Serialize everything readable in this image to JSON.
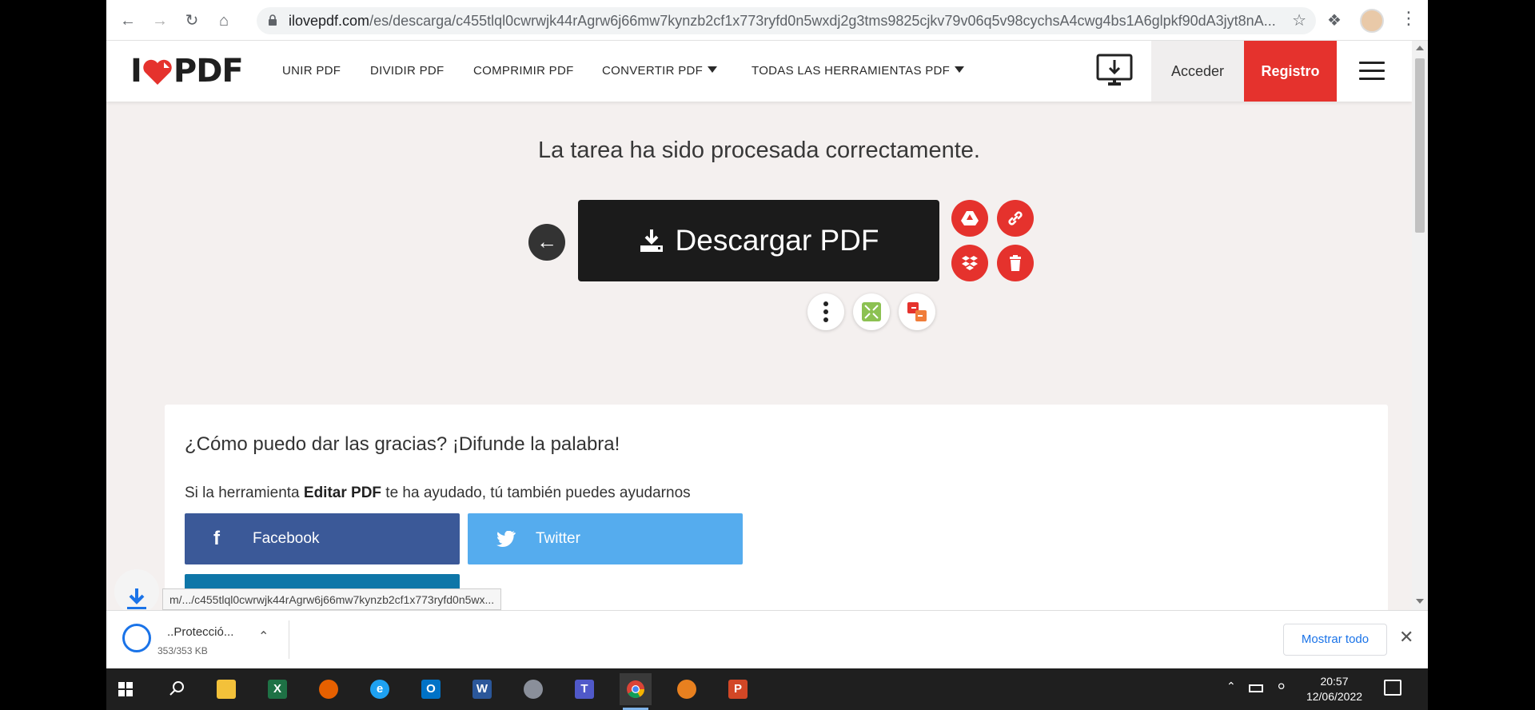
{
  "browser": {
    "url_host": "ilovepdf.com",
    "url_path": "/es/descarga/c455tlql0cwrwjk44rAgrw6j66mw7kynzb2cf1x773ryfd0n5wxdj2g3tms9825cjkv79v06q5v98cychsA4cwg4bs1A6glpkf90dA3jyt8nA..."
  },
  "site": {
    "logo_text": "I",
    "logo_text2": "PDF",
    "nav": {
      "unir": "UNIR PDF",
      "dividir": "DIVIDIR PDF",
      "comprimir": "COMPRIMIR PDF",
      "convertir": "CONVERTIR PDF",
      "todas": "TODAS LAS HERRAMIENTAS PDF"
    },
    "login": "Acceder",
    "register": "Registro"
  },
  "main": {
    "heading": "La tarea ha sido procesada correctamente.",
    "download_label": "Descargar PDF"
  },
  "share": {
    "title": "¿Cómo puedo dar las gracias? ¡Difunde la palabra!",
    "text_before": "Si la herramienta ",
    "tool_name": "Editar PDF",
    "text_after": " te ha ayudado, tú también puedes ayudarnos",
    "facebook": "Facebook",
    "twitter": "Twitter"
  },
  "status_url": "m/.../c455tlql0cwrwjk44rAgrw6j66mw7kynzb2cf1x773ryfd0n5wx...",
  "downloads": {
    "file_name": "..Protecció...",
    "file_size": "353/353 KB",
    "show_all": "Mostrar todo"
  },
  "taskbar": {
    "time": "20:57",
    "date": "12/06/2022"
  },
  "colors": {
    "brand_red": "#e5322d",
    "facebook": "#3b5998",
    "twitter": "#55acee"
  }
}
